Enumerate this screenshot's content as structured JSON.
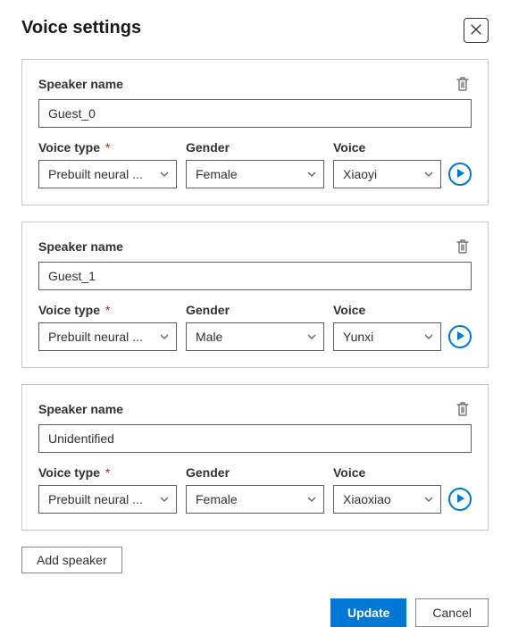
{
  "title": "Voice settings",
  "labels": {
    "speaker_name": "Speaker name",
    "voice_type": "Voice type",
    "gender": "Gender",
    "voice": "Voice"
  },
  "voice_type_display": "Prebuilt neural ...",
  "speakers": [
    {
      "name": "Guest_0",
      "gender": "Female",
      "voice": "Xiaoyi"
    },
    {
      "name": "Guest_1",
      "gender": "Male",
      "voice": "Yunxi"
    },
    {
      "name": "Unidentified",
      "gender": "Female",
      "voice": "Xiaoxiao"
    }
  ],
  "buttons": {
    "add_speaker": "Add speaker",
    "update": "Update",
    "cancel": "Cancel"
  }
}
